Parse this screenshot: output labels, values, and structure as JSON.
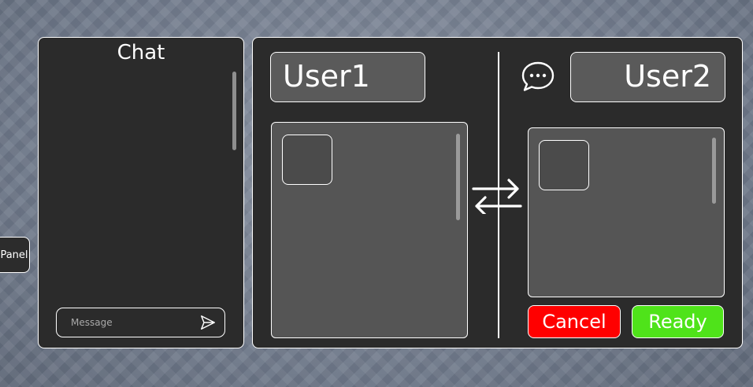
{
  "side_tab": {
    "label": "Panel"
  },
  "chat": {
    "title": "Chat",
    "message_placeholder": "Message",
    "message_value": "",
    "send_icon": "send-arrow-icon"
  },
  "trade": {
    "user1": {
      "name": "User1"
    },
    "user2": {
      "name": "User2"
    },
    "chat_icon": "chat-bubble-icon",
    "swap_icon": "swap-arrows-icon",
    "buttons": {
      "cancel_label": "Cancel",
      "ready_label": "Ready"
    }
  },
  "colors": {
    "panel_bg": "#2b2b2b",
    "inventory_bg": "#555555",
    "cancel": "#ff0000",
    "ready": "#4fe31a",
    "border": "#ffffff"
  }
}
